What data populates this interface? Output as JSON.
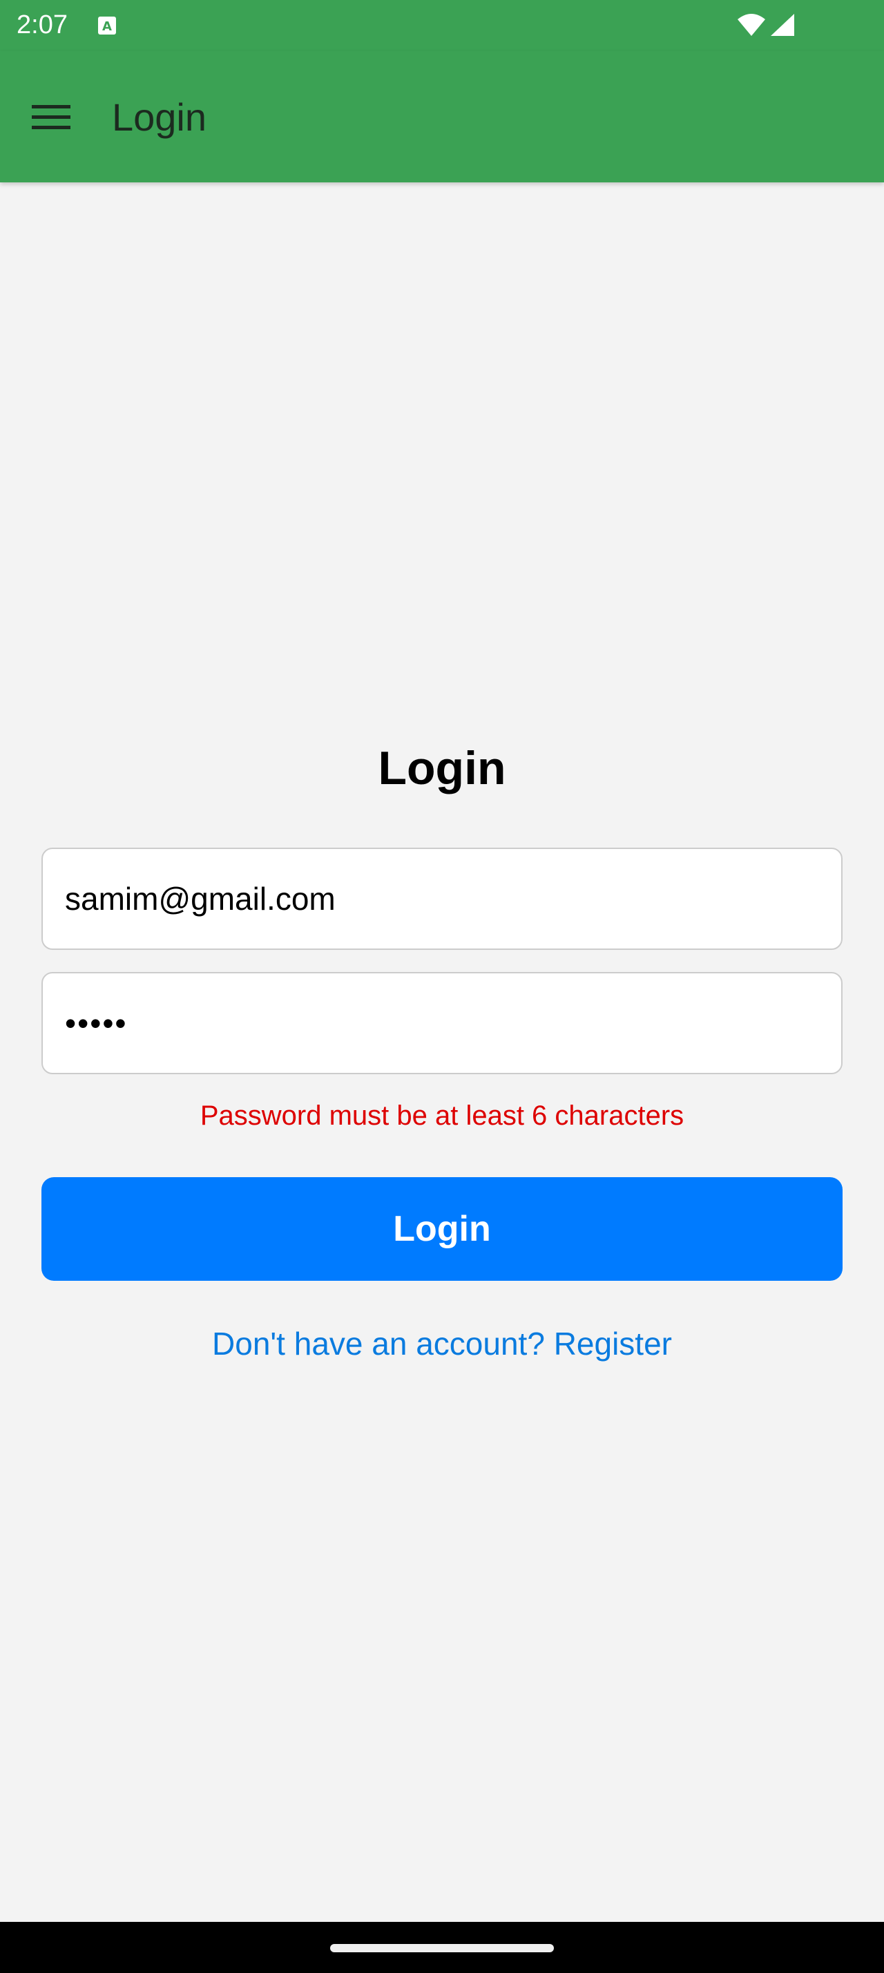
{
  "status_bar": {
    "time": "2:07",
    "icons": [
      "a-notification-icon",
      "wifi-icon",
      "signal-icon"
    ]
  },
  "app_bar": {
    "title": "Login",
    "menu_icon": "hamburger-menu-icon",
    "background_color": "#3ba254"
  },
  "form": {
    "heading": "Login",
    "email_value": "samim@gmail.com",
    "password_value": "•••••",
    "error_message": "Password must be at least 6 characters",
    "login_label": "Login",
    "register_link": "Don't have an account? Register"
  },
  "colors": {
    "primary_button": "#007bff",
    "error": "#dd0000",
    "link": "#0a7bdf",
    "background": "#f3f3f3"
  }
}
